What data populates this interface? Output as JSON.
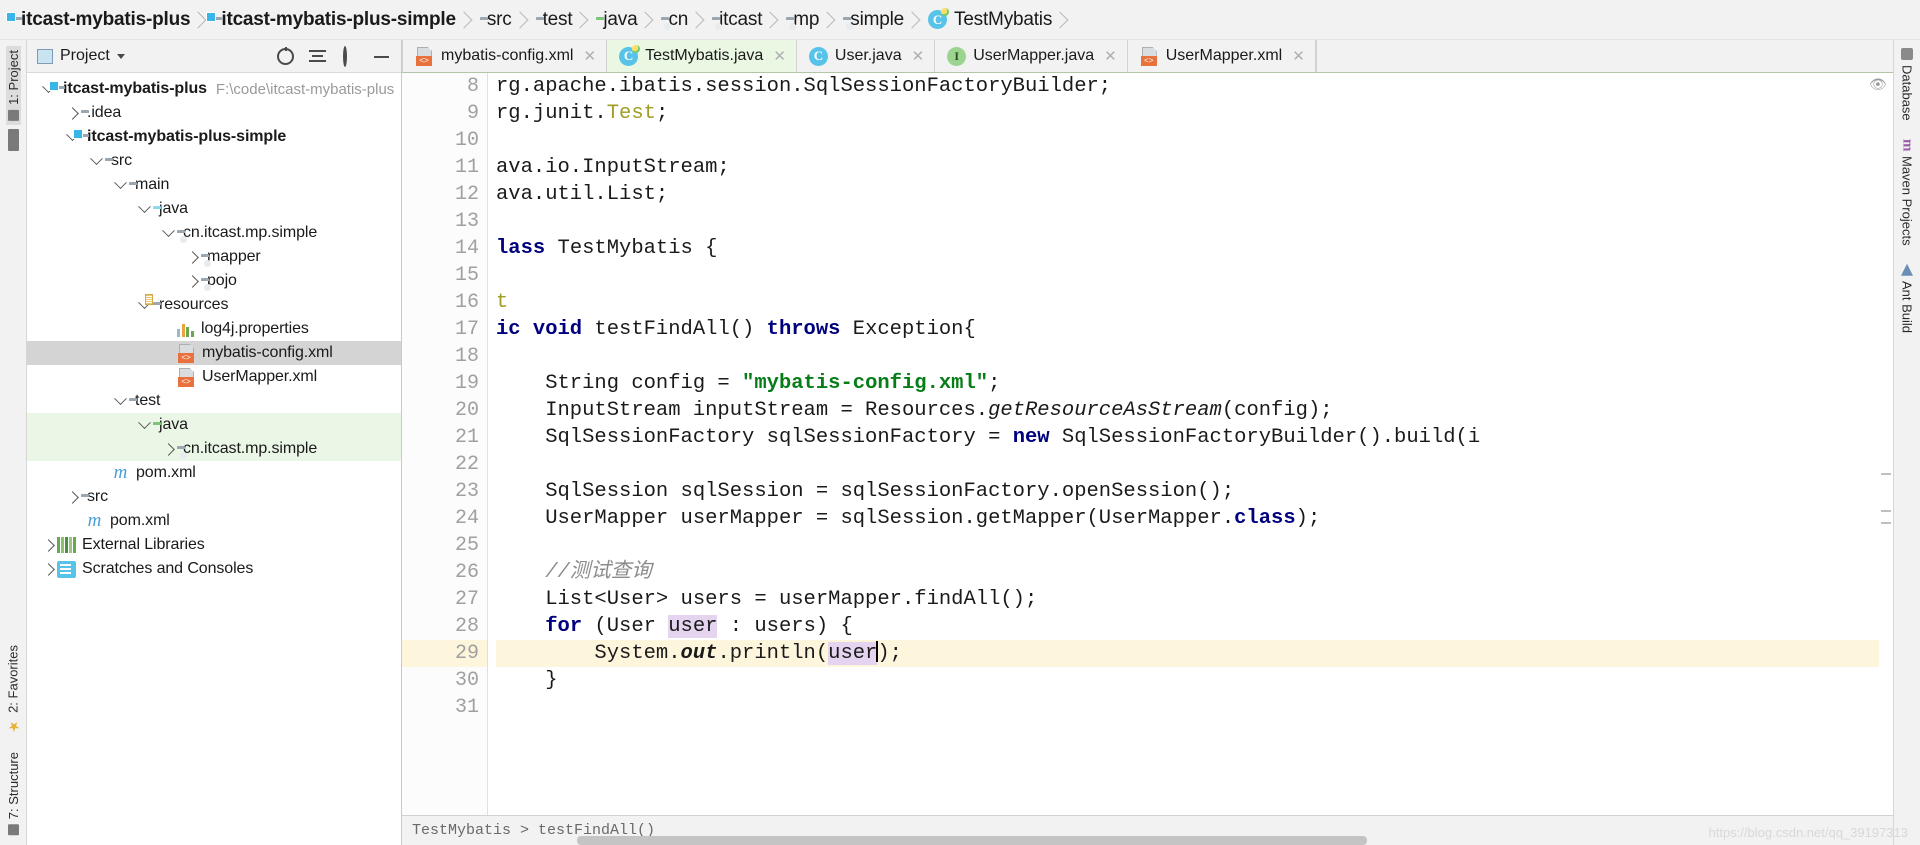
{
  "breadcrumb": [
    {
      "label": "itcast-mybatis-plus",
      "icon": "module-folder-icon",
      "bold": true
    },
    {
      "label": "itcast-mybatis-plus-simple",
      "icon": "module-folder-icon",
      "bold": true
    },
    {
      "label": "src",
      "icon": "folder-icon",
      "bold": false
    },
    {
      "label": "test",
      "icon": "folder-icon",
      "bold": false
    },
    {
      "label": "java",
      "icon": "source-folder-icon",
      "bold": false
    },
    {
      "label": "cn",
      "icon": "package-icon",
      "bold": false
    },
    {
      "label": "itcast",
      "icon": "package-icon",
      "bold": false
    },
    {
      "label": "mp",
      "icon": "package-icon",
      "bold": false
    },
    {
      "label": "simple",
      "icon": "package-icon",
      "bold": false
    },
    {
      "label": "TestMybatis",
      "icon": "test-class-icon",
      "bold": false
    }
  ],
  "left_strip": {
    "top_tab": "1: Project",
    "mid_tab": "2: Favorites",
    "bottom_tab": "7: Structure"
  },
  "right_strip": {
    "tabs": [
      "Database",
      "Maven Projects",
      "Ant Build"
    ]
  },
  "project_panel": {
    "title": "Project",
    "icons": [
      "locate-icon",
      "collapse-all-icon",
      "gear-icon",
      "minimize-icon"
    ],
    "tree": [
      {
        "depth": 0,
        "toggle": "down",
        "icon": "module-folder-icon",
        "label": "itcast-mybatis-plus",
        "bold": true,
        "path": "F:\\code\\itcast-mybatis-plus",
        "row": ""
      },
      {
        "depth": 1,
        "toggle": "right",
        "icon": "folder-icon",
        "label": ".idea",
        "bold": false,
        "path": "",
        "row": ""
      },
      {
        "depth": 1,
        "toggle": "down",
        "icon": "module-folder-icon",
        "label": "itcast-mybatis-plus-simple",
        "bold": true,
        "path": "",
        "row": ""
      },
      {
        "depth": 2,
        "toggle": "down",
        "icon": "folder-icon",
        "label": "src",
        "bold": false,
        "path": "",
        "row": ""
      },
      {
        "depth": 3,
        "toggle": "down",
        "icon": "folder-icon",
        "label": "main",
        "bold": false,
        "path": "",
        "row": ""
      },
      {
        "depth": 4,
        "toggle": "down",
        "icon": "source-folder-icon",
        "label": "java",
        "bold": false,
        "path": "",
        "row": ""
      },
      {
        "depth": 5,
        "toggle": "down",
        "icon": "package-icon",
        "label": "cn.itcast.mp.simple",
        "bold": false,
        "path": "",
        "row": ""
      },
      {
        "depth": 6,
        "toggle": "right",
        "icon": "package-icon",
        "label": "mapper",
        "bold": false,
        "path": "",
        "row": ""
      },
      {
        "depth": 6,
        "toggle": "right",
        "icon": "package-icon",
        "label": "pojo",
        "bold": false,
        "path": "",
        "row": ""
      },
      {
        "depth": 4,
        "toggle": "down",
        "icon": "resource-folder-icon",
        "label": "resources",
        "bold": false,
        "path": "",
        "row": ""
      },
      {
        "depth": 5,
        "toggle": "none",
        "icon": "properties-icon",
        "label": "log4j.properties",
        "bold": false,
        "path": "",
        "row": ""
      },
      {
        "depth": 5,
        "toggle": "none",
        "icon": "xml-file-icon",
        "label": "mybatis-config.xml",
        "bold": false,
        "path": "",
        "row": "selected"
      },
      {
        "depth": 5,
        "toggle": "none",
        "icon": "xml-file-icon",
        "label": "UserMapper.xml",
        "bold": false,
        "path": "",
        "row": ""
      },
      {
        "depth": 3,
        "toggle": "down",
        "icon": "folder-icon",
        "label": "test",
        "bold": false,
        "path": "",
        "row": ""
      },
      {
        "depth": 4,
        "toggle": "down",
        "icon": "test-source-folder-icon",
        "label": "java",
        "bold": false,
        "path": "",
        "row": "green"
      },
      {
        "depth": 5,
        "toggle": "right",
        "icon": "package-icon",
        "label": "cn.itcast.mp.simple",
        "bold": false,
        "path": "",
        "row": "green"
      },
      {
        "depth": 3,
        "toggle": "none",
        "icon": "maven-icon",
        "label": "pom.xml",
        "bold": false,
        "path": "",
        "row": ""
      },
      {
        "depth": 1,
        "toggle": "right",
        "icon": "folder-icon",
        "label": "src",
        "bold": false,
        "path": "",
        "row": ""
      },
      {
        "depth": 1,
        "toggle": "none",
        "icon": "maven-icon",
        "label": "pom.xml",
        "bold": false,
        "path": "",
        "row": ""
      },
      {
        "depth": 0,
        "toggle": "right",
        "icon": "libraries-icon",
        "label": "External Libraries",
        "bold": false,
        "path": "",
        "row": ""
      },
      {
        "depth": 0,
        "toggle": "right",
        "icon": "scratches-icon",
        "label": "Scratches and Consoles",
        "bold": false,
        "path": "",
        "row": ""
      }
    ]
  },
  "editor_tabs": [
    {
      "label": "mybatis-config.xml",
      "icon": "xml-file-icon",
      "active": false
    },
    {
      "label": "TestMybatis.java",
      "icon": "test-class-icon",
      "active": true
    },
    {
      "label": "User.java",
      "icon": "class-icon",
      "active": false
    },
    {
      "label": "UserMapper.java",
      "icon": "interface-icon",
      "active": false
    },
    {
      "label": "UserMapper.xml",
      "icon": "xml-file-icon",
      "active": false
    }
  ],
  "code": {
    "first_visible_line": 8,
    "current_line": 29,
    "caret": {
      "line": 29,
      "column": 31
    },
    "horizontally_scrolled": true,
    "lines": [
      {
        "n": 8,
        "marker": "",
        "fold": "",
        "text": "rg.apache.ibatis.session.SqlSessionFactoryBuilder;"
      },
      {
        "n": 9,
        "marker": "",
        "fold": "",
        "text": "rg.junit.Test;"
      },
      {
        "n": 10,
        "marker": "",
        "fold": "",
        "text": ""
      },
      {
        "n": 11,
        "marker": "",
        "fold": "",
        "text": "ava.io.InputStream;"
      },
      {
        "n": 12,
        "marker": "",
        "fold": "fold-minus",
        "text": "ava.util.List;"
      },
      {
        "n": 13,
        "marker": "",
        "fold": "",
        "text": ""
      },
      {
        "n": 14,
        "marker": "run-all",
        "fold": "",
        "text": "lass TestMybatis {"
      },
      {
        "n": 15,
        "marker": "",
        "fold": "",
        "text": ""
      },
      {
        "n": 16,
        "marker": "",
        "fold": "",
        "text": "t"
      },
      {
        "n": 17,
        "marker": "run",
        "fold": "fold-tip",
        "text": "ic void testFindAll() throws Exception{"
      },
      {
        "n": 18,
        "marker": "",
        "fold": "",
        "text": ""
      },
      {
        "n": 19,
        "marker": "",
        "fold": "",
        "text": "    String config = \"mybatis-config.xml\";"
      },
      {
        "n": 20,
        "marker": "",
        "fold": "",
        "text": "    InputStream inputStream = Resources.getResourceAsStream(config);"
      },
      {
        "n": 21,
        "marker": "",
        "fold": "",
        "text": "    SqlSessionFactory sqlSessionFactory = new SqlSessionFactoryBuilder().build(i"
      },
      {
        "n": 22,
        "marker": "",
        "fold": "",
        "text": ""
      },
      {
        "n": 23,
        "marker": "",
        "fold": "",
        "text": "    SqlSession sqlSession = sqlSessionFactory.openSession();"
      },
      {
        "n": 24,
        "marker": "",
        "fold": "",
        "text": "    UserMapper userMapper = sqlSession.getMapper(UserMapper.class);"
      },
      {
        "n": 25,
        "marker": "",
        "fold": "",
        "text": ""
      },
      {
        "n": 26,
        "marker": "",
        "fold": "",
        "text": "    //测试查询"
      },
      {
        "n": 27,
        "marker": "",
        "fold": "",
        "text": "    List<User> users = userMapper.findAll();"
      },
      {
        "n": 28,
        "marker": "",
        "fold": "",
        "text": "    for (User user : users) {"
      },
      {
        "n": 29,
        "marker": "",
        "fold": "",
        "text": "        System.out.println(user);"
      },
      {
        "n": 30,
        "marker": "",
        "fold": "",
        "text": "    }"
      },
      {
        "n": 31,
        "marker": "",
        "fold": "",
        "text": ""
      }
    ]
  },
  "status_bar": {
    "text": "TestMybatis > testFindAll()",
    "watermark": "https://blog.csdn.net/qq_39197313"
  },
  "colors": {
    "keyword": "#00007f",
    "string": "#067d17",
    "comment": "#8c8c8c",
    "annotation": "#9e9e22",
    "current_line": "#fdf6dd",
    "selection": "#d4d4d4",
    "test_source_row": "#eaf6e6",
    "active_tab": "#eaf7e2",
    "identifier_highlight": "#e4d4f0"
  }
}
